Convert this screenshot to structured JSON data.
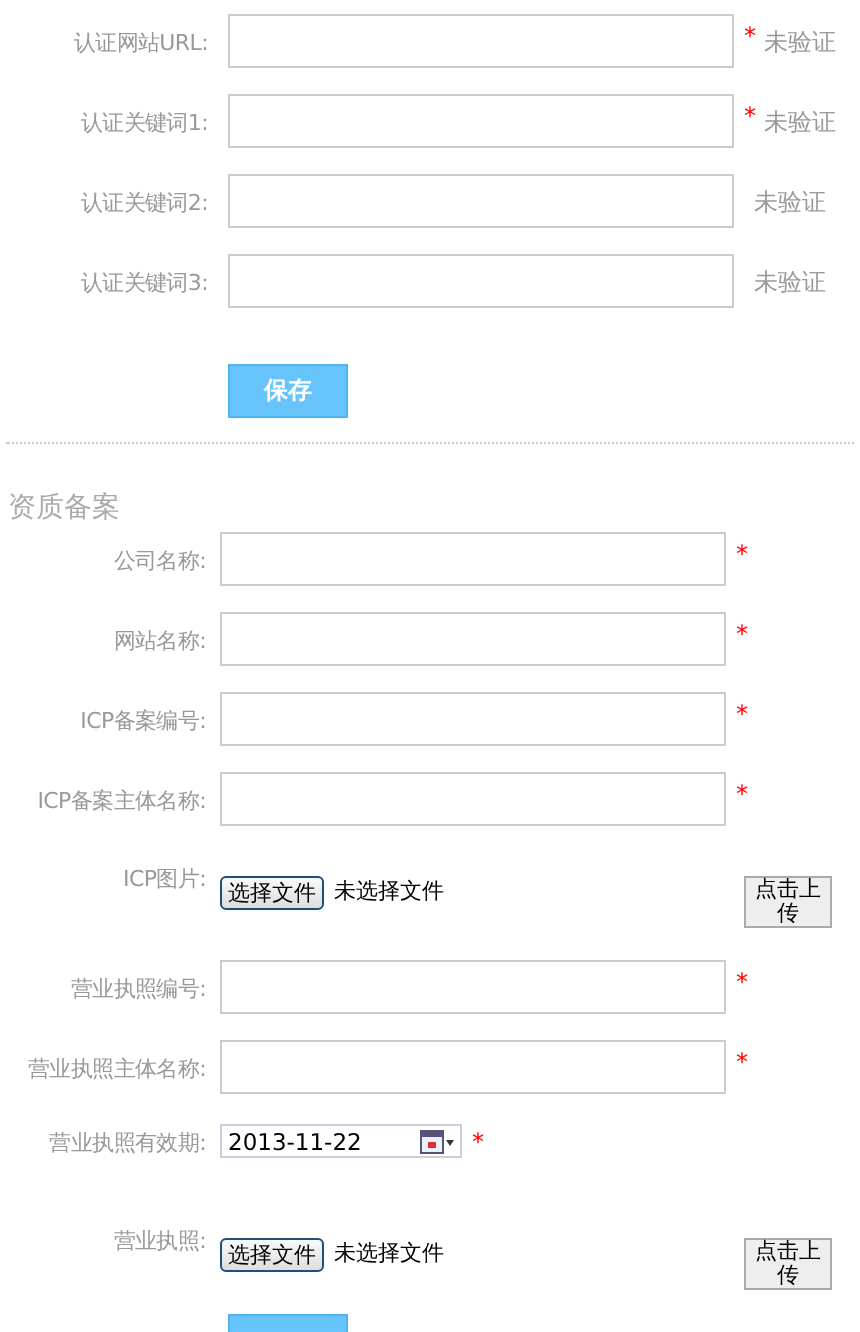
{
  "verification": {
    "fields": [
      {
        "label": "认证网站URL:",
        "required_mark": "*",
        "status": "未验证"
      },
      {
        "label": "认证关键词1:",
        "required_mark": "*",
        "status": "未验证"
      },
      {
        "label": "认证关键词2:",
        "status": "未验证"
      },
      {
        "label": "认证关键词3:",
        "status": "未验证"
      }
    ],
    "save_button": "保存"
  },
  "qualification": {
    "title": "资质备案",
    "fields": [
      {
        "kind": "text",
        "label": "公司名称:",
        "required_mark": "*"
      },
      {
        "kind": "text",
        "label": "网站名称:",
        "required_mark": "*"
      },
      {
        "kind": "text",
        "label": "ICP备案编号:",
        "required_mark": "*"
      },
      {
        "kind": "text",
        "label": "ICP备案主体名称:",
        "required_mark": "*"
      },
      {
        "kind": "file",
        "label": "ICP图片:",
        "choose_button": "选择文件",
        "file_status": "未选择文件",
        "upload_button": "点击上传"
      },
      {
        "kind": "text",
        "label": "营业执照编号:",
        "required_mark": "*"
      },
      {
        "kind": "text",
        "label": "营业执照主体名称:",
        "required_mark": "*"
      },
      {
        "kind": "date",
        "label": "营业执照有效期:",
        "required_mark": "*",
        "value": "2013-11-22"
      },
      {
        "kind": "file",
        "label": "营业执照:",
        "choose_button": "选择文件",
        "file_status": "未选择文件",
        "upload_button": "点击上传"
      }
    ]
  }
}
